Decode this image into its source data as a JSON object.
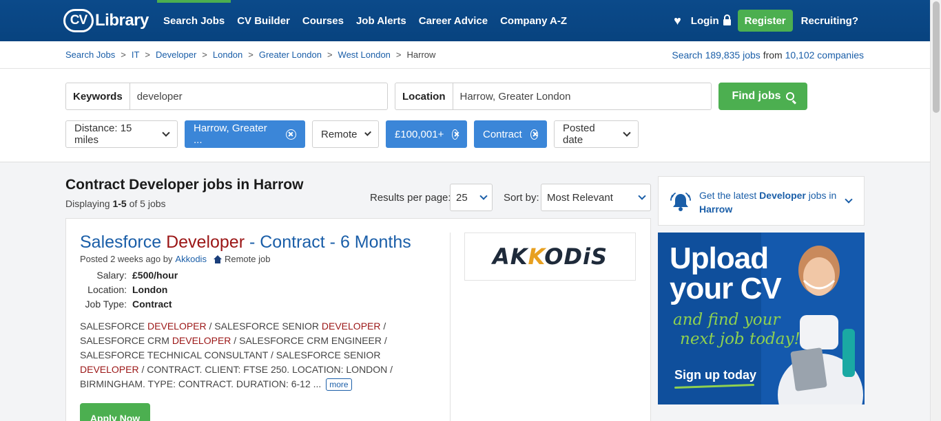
{
  "header": {
    "logo_cv": "CV",
    "logo_text": "Library",
    "nav": [
      "Search Jobs",
      "CV Builder",
      "Courses",
      "Job Alerts",
      "Career Advice",
      "Company A-Z"
    ],
    "login": "Login",
    "register": "Register",
    "recruiting": "Recruiting?"
  },
  "breadcrumb": [
    "Search Jobs",
    "IT",
    "Developer",
    "London",
    "Greater London",
    "West London",
    "Harrow"
  ],
  "stats": {
    "pre": "Search",
    "jobs": "189,835 jobs",
    "mid": "from",
    "companies": "10,102 companies"
  },
  "search": {
    "keywords_label": "Keywords",
    "keywords_value": "developer",
    "location_label": "Location",
    "location_value": "Harrow, Greater London",
    "find_button": "Find jobs"
  },
  "filters": {
    "distance": "Distance: 15 miles",
    "location": "Harrow, Greater ...",
    "remote": "Remote",
    "salary": "£100,001+",
    "job_type": "Contract",
    "posted": "Posted date"
  },
  "results": {
    "title": "Contract Developer jobs in Harrow",
    "displaying_pre": "Displaying",
    "range": "1-5",
    "of_text": "of 5 jobs",
    "per_page_label": "Results per page:",
    "per_page_value": "25",
    "sort_label": "Sort by:",
    "sort_value": "Most Relevant"
  },
  "job": {
    "title_pre": "Salesforce",
    "title_hl": "Developer",
    "title_post": "- Contract - 6 Months",
    "posted": "Posted 2 weeks ago by",
    "company": "Akkodis",
    "remote": "Remote job",
    "salary_label": "Salary:",
    "salary": "£500/hour",
    "location_label": "Location:",
    "location": "London",
    "type_label": "Job Type:",
    "type": "Contract",
    "desc": [
      {
        "t": "SALESFORCE ",
        "hl": false
      },
      {
        "t": "DEVELOPER",
        "hl": true
      },
      {
        "t": " / SALESFORCE SENIOR ",
        "hl": false
      },
      {
        "t": "DEVELOPER",
        "hl": true
      },
      {
        "t": " / SALESFORCE CRM ",
        "hl": false
      },
      {
        "t": "DEVELOPER",
        "hl": true
      },
      {
        "t": " / SALESFORCE CRM ENGINEER / SALESFORCE TECHNICAL CONSULTANT / SALESFORCE SENIOR ",
        "hl": false
      },
      {
        "t": "DEVELOPER",
        "hl": true
      },
      {
        "t": " / CONTRACT. CLIENT: FTSE 250. LOCATION: LONDON / BIRMINGHAM. TYPE: CONTRACT. DURATION: 6-12 ...",
        "hl": false
      }
    ],
    "more": "more",
    "apply": "Apply Now",
    "logo_text_a": "AK",
    "logo_text_accent": "K",
    "logo_text_b": "ODiS"
  },
  "alert": {
    "pre": "Get the latest",
    "keyword": "Developer",
    "mid": "jobs in",
    "place": "Harrow"
  },
  "promo": {
    "line1": "Upload",
    "line2": "your CV",
    "script1": "and find your",
    "script2": "next job today!",
    "cta": "Sign up today"
  },
  "colors": {
    "header": "#0b4a8a",
    "accent_green": "#4caf50",
    "link": "#1a5ea8",
    "highlight": "#9b1616",
    "chip_active": "#3b86d8"
  }
}
